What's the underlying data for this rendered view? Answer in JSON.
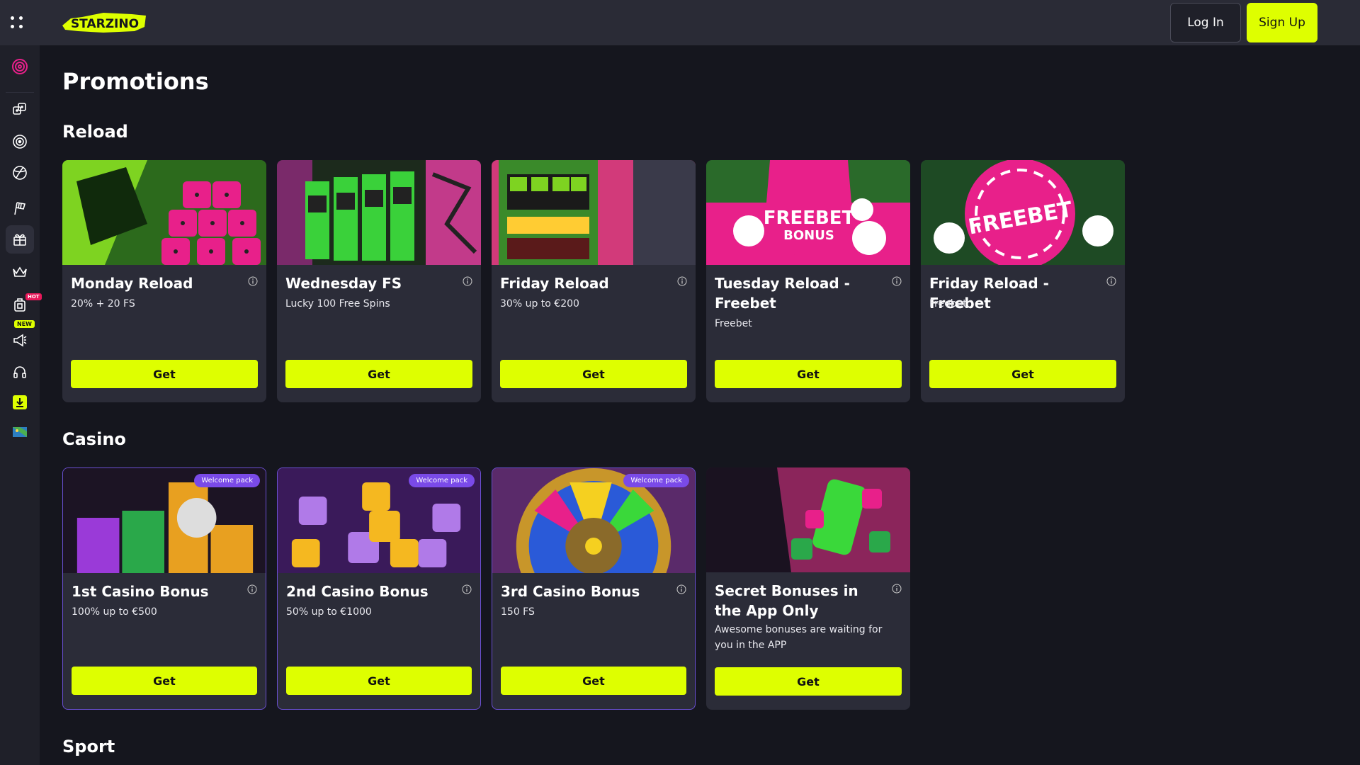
{
  "header": {
    "logo_text": "STARZINO",
    "login_label": "Log In",
    "signup_label": "Sign Up"
  },
  "sidebar": {
    "items": [
      {
        "name": "target-icon"
      },
      {
        "name": "dice-icon"
      },
      {
        "name": "roulette-icon"
      },
      {
        "name": "sports-ball-icon"
      },
      {
        "name": "racing-flag-icon"
      },
      {
        "name": "gift-icon"
      },
      {
        "name": "crown-icon"
      },
      {
        "name": "hot-games-icon",
        "badge": "HOT"
      },
      {
        "name": "megaphone-icon",
        "badge": "NEW"
      },
      {
        "name": "support-headset-icon"
      },
      {
        "name": "download-icon"
      },
      {
        "name": "language-flag-icon"
      }
    ]
  },
  "page": {
    "title": "Promotions"
  },
  "sections": {
    "reload": {
      "title": "Reload",
      "cards": [
        {
          "title": "Monday Reload",
          "subtitle": "20% + 20 FS",
          "button": "Get"
        },
        {
          "title": "Wednesday FS",
          "subtitle": "Lucky 100 Free Spins",
          "button": "Get"
        },
        {
          "title": "Friday Reload",
          "subtitle": "30% up to €200",
          "button": "Get"
        },
        {
          "title": "Tuesday Reload - Freebet",
          "subtitle": "Freebet",
          "button": "Get",
          "image_text": [
            "FREEBET",
            "BONUS"
          ]
        },
        {
          "title": "Friday Reload - Freebet",
          "subtitle": "Freebet",
          "button": "Get",
          "image_text": [
            "FREEBET"
          ]
        }
      ]
    },
    "casino": {
      "title": "Casino",
      "cards": [
        {
          "title": "1st Casino Bonus",
          "subtitle": "100% up to €500",
          "button": "Get",
          "badge": "Welcome pack"
        },
        {
          "title": "2nd Casino Bonus",
          "subtitle": "50% up to €1000",
          "button": "Get",
          "badge": "Welcome pack"
        },
        {
          "title": "3rd Casino Bonus",
          "subtitle": "150 FS",
          "button": "Get",
          "badge": "Welcome pack"
        },
        {
          "title": "Secret Bonuses in the App Only",
          "subtitle": "Awesome bonuses are waiting for you in the APP",
          "button": "Get"
        }
      ]
    },
    "sport": {
      "title": "Sport"
    }
  },
  "colors": {
    "accent": "#deff00",
    "background": "#15161e",
    "card": "#2b2c38",
    "welcome_border": "#6a4fd1",
    "badge": "#7a4ae8",
    "pink": "#e8208a"
  }
}
